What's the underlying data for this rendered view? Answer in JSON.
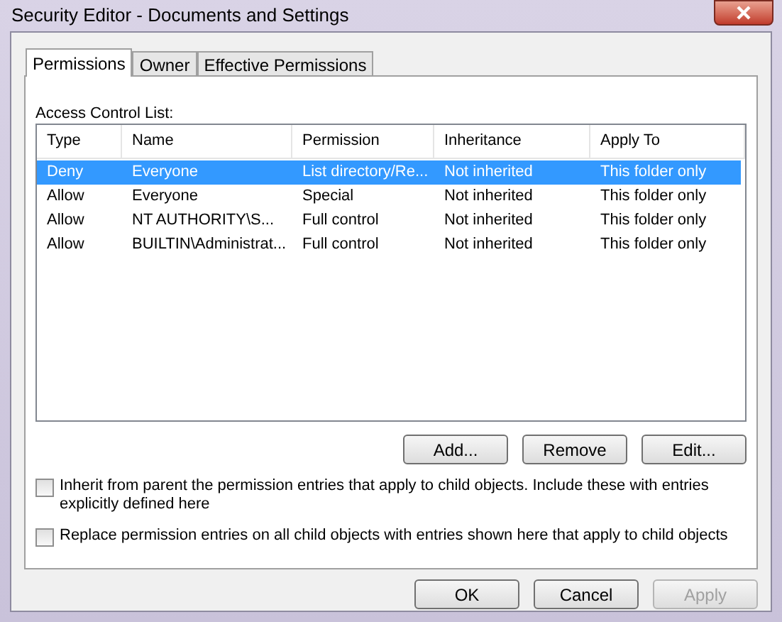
{
  "window": {
    "title": "Security Editor - Documents and Settings"
  },
  "tabs": [
    {
      "label": "Permissions",
      "selected": true
    },
    {
      "label": "Owner",
      "selected": false
    },
    {
      "label": "Effective Permissions",
      "selected": false
    }
  ],
  "access_control_list": {
    "label": "Access Control List:",
    "columns": [
      "Type",
      "Name",
      "Permission",
      "Inheritance",
      "Apply To"
    ],
    "rows": [
      {
        "cells": [
          "Deny",
          "Everyone",
          "List directory/Re...",
          "Not inherited",
          "This folder only"
        ],
        "selected": true
      },
      {
        "cells": [
          "Allow",
          "Everyone",
          "Special",
          "Not inherited",
          "This folder only"
        ],
        "selected": false
      },
      {
        "cells": [
          "Allow",
          "NT AUTHORITY\\S...",
          "Full control",
          "Not inherited",
          "This folder only"
        ],
        "selected": false
      },
      {
        "cells": [
          "Allow",
          "BUILTIN\\Administrat...",
          "Full control",
          "Not inherited",
          "This folder only"
        ],
        "selected": false
      }
    ]
  },
  "list_buttons": [
    {
      "label": "Add...",
      "disabled": false
    },
    {
      "label": "Remove",
      "disabled": false
    },
    {
      "label": "Edit...",
      "disabled": false
    }
  ],
  "options": [
    {
      "label": "Inherit from parent the permission entries that apply to child objects. Include these with entries explicitly defined here",
      "checked": false
    },
    {
      "label": "Replace permission entries on all child objects with entries shown here that apply to child objects",
      "checked": false
    }
  ],
  "dialog_buttons": [
    {
      "label": "OK",
      "disabled": false
    },
    {
      "label": "Cancel",
      "disabled": false
    },
    {
      "label": "Apply",
      "disabled": true
    }
  ]
}
